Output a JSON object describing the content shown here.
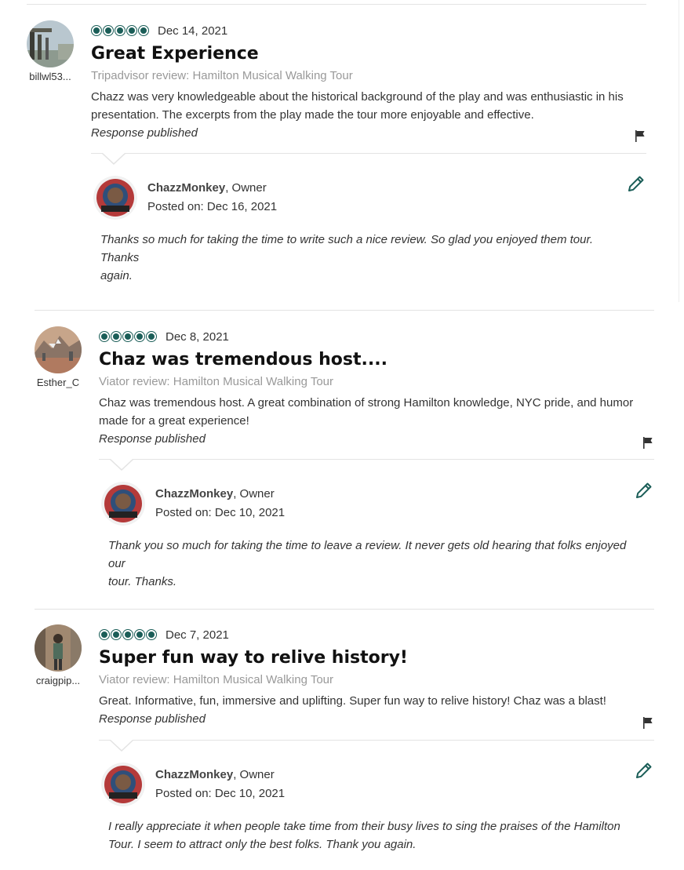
{
  "reviews": [
    {
      "username": "billwl53...",
      "rating": 5,
      "date": "Dec 14, 2021",
      "title": "Great Experience",
      "source": "Tripadvisor review: Hamilton Musical Walking Tour",
      "text": "Chazz was very knowledgeable about the historical background of the play and was enthusiastic in his presentation. The excerpts from the play made the tour more enjoyable and effective.",
      "status": "Response published",
      "response": {
        "author": "ChazzMonkey",
        "role": ", Owner",
        "posted_label": "Posted on:",
        "posted_date": "Dec 16, 2021",
        "line1": "Thanks so much for taking the time to write such a nice review. So glad you enjoyed them tour.",
        "line2": "Thanks",
        "line3": "again."
      }
    },
    {
      "username": "Esther_C",
      "rating": 5,
      "date": "Dec 8, 2021",
      "title": "Chaz was tremendous host....",
      "source": "Viator review: Hamilton Musical Walking Tour",
      "text": "Chaz was tremendous host. A great combination of strong Hamilton knowledge, NYC pride, and humor made for a great experience!",
      "status": "Response published",
      "response": {
        "author": "ChazzMonkey",
        "role": ", Owner",
        "posted_label": "Posted on:",
        "posted_date": "Dec 10, 2021",
        "line1": "Thank you so much for taking the time to leave a review. It never gets old hearing that folks enjoyed",
        "line2": "our",
        "line3": "tour. Thanks."
      }
    },
    {
      "username": "craigpip...",
      "rating": 5,
      "date": "Dec 7, 2021",
      "title": "Super fun way to relive history!",
      "source": "Viator review: Hamilton Musical Walking Tour",
      "text": "Great. Informative, fun, immersive and uplifting. Super fun way to relive history! Chaz was a blast!",
      "status": "Response published",
      "response": {
        "author": "ChazzMonkey",
        "role": ", Owner",
        "posted_label": "Posted on:",
        "posted_date": "Dec 10, 2021",
        "line1": "I really appreciate it when people take time from their busy lives to sing the praises of the Hamilton",
        "line2": "Tour. I seem to attract only the best folks. Thank you again.",
        "line3": ""
      }
    }
  ],
  "colors": {
    "bubble": "#1b5e58",
    "edit_icon": "#1b5e58",
    "divider": "#e3e3e3"
  }
}
